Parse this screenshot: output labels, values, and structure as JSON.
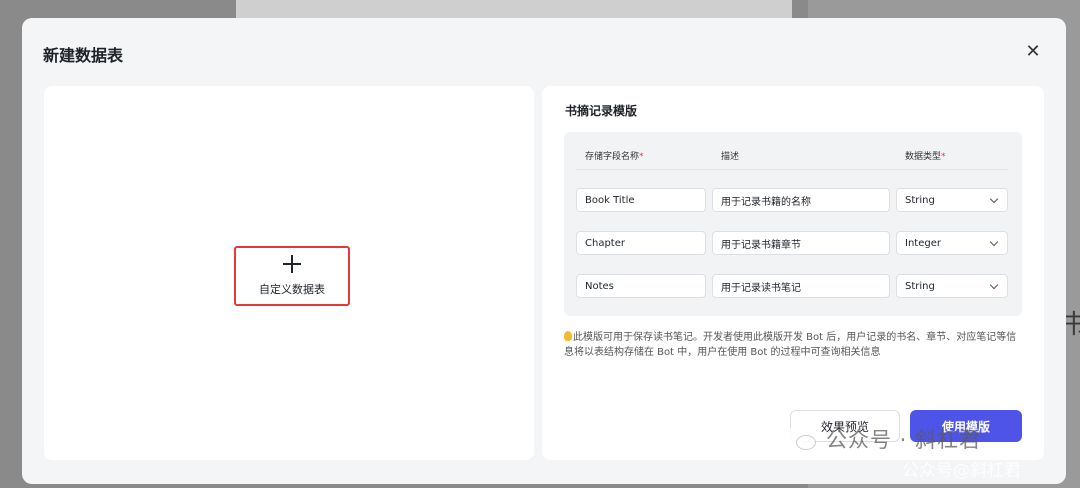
{
  "modal": {
    "title": "新建数据表",
    "close": "✕"
  },
  "custom": {
    "label": "自定义数据表"
  },
  "template": {
    "title": "书摘记录模版",
    "headers": {
      "name": "存储字段名称",
      "desc": "描述",
      "type": "数据类型",
      "required_mark": "*"
    },
    "rows": [
      {
        "name": "Book Title",
        "desc": "用于记录书籍的名称",
        "type": "String"
      },
      {
        "name": "Chapter",
        "desc": "用于记录书籍章节",
        "type": "Integer"
      },
      {
        "name": "Notes",
        "desc": "用于记录读书笔记",
        "type": "String"
      }
    ],
    "note": "此模版可用于保存读书笔记。开发者使用此模版开发 Bot 后，用户记录的书名、章节、对应笔记等信息将以表结构存储在 Bot 中，用户在使用 Bot 的过程中可查询相关信息"
  },
  "buttons": {
    "preview": "效果预览",
    "use": "使用模版"
  },
  "watermark": {
    "main": "公众号 · 斜杠君",
    "sub": "公众号@斜杠君"
  },
  "background": {
    "glyph": "书"
  },
  "colors": {
    "accent": "#4e54e8",
    "highlight_border": "#e53935",
    "required": "#e53935"
  }
}
